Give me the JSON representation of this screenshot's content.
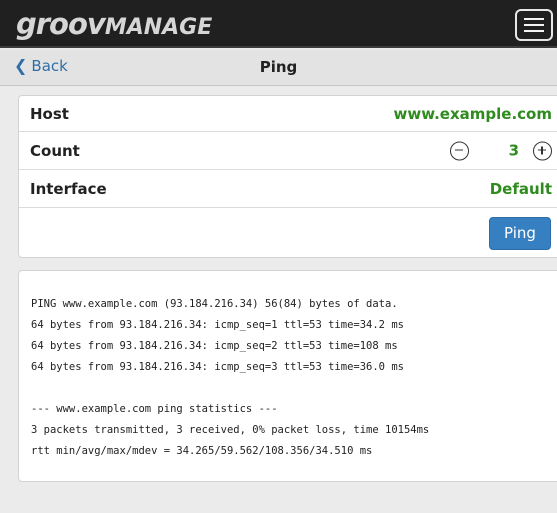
{
  "header": {
    "logo_part1": "groov",
    "logo_part2": "MANAGE",
    "menu_icon": "hamburger-menu-icon"
  },
  "nav": {
    "back_label": "Back",
    "back_icon": "chevron-left-icon",
    "title": "Ping"
  },
  "form": {
    "host_label": "Host",
    "host_value": "www.example.com",
    "count_label": "Count",
    "count_value": "3",
    "interface_label": "Interface",
    "interface_value": "Default",
    "ping_button": "Ping",
    "decrement_icon": "minus-circle-icon",
    "increment_icon": "plus-circle-icon"
  },
  "output": {
    "lines": [
      "PING www.example.com (93.184.216.34) 56(84) bytes of data.",
      "64 bytes from 93.184.216.34: icmp_seq=1 ttl=53 time=34.2 ms",
      "64 bytes from 93.184.216.34: icmp_seq=2 ttl=53 time=108 ms",
      "64 bytes from 93.184.216.34: icmp_seq=3 ttl=53 time=36.0 ms",
      "",
      "--- www.example.com ping statistics ---",
      "3 packets transmitted, 3 received, 0% packet loss, time 10154ms",
      "rtt min/avg/max/mdev = 34.265/59.562/108.356/34.510 ms"
    ]
  },
  "colors": {
    "header_bg": "#202020",
    "accent_green": "#2e8b1e",
    "link_blue": "#2f6ea8",
    "button_blue": "#3680c2"
  }
}
